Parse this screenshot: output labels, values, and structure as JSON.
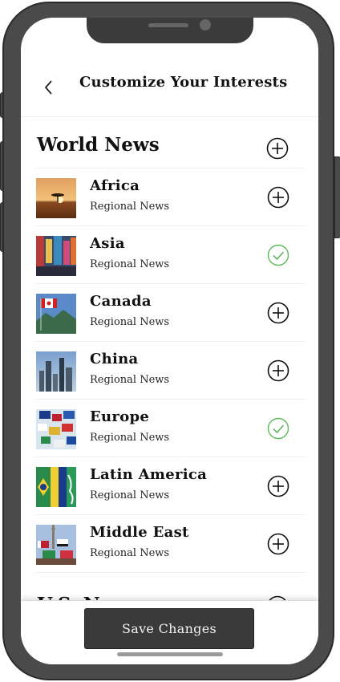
{
  "header": {
    "title": "Customize Your Interests"
  },
  "section": {
    "title": "World News"
  },
  "topics": [
    {
      "name": "Africa",
      "subtitle": "Regional News",
      "selected": false,
      "thumb": "africa-sunset"
    },
    {
      "name": "Asia",
      "subtitle": "Regional News",
      "selected": true,
      "thumb": "asia-street"
    },
    {
      "name": "Canada",
      "subtitle": "Regional News",
      "selected": false,
      "thumb": "canada-flag"
    },
    {
      "name": "China",
      "subtitle": "Regional News",
      "selected": false,
      "thumb": "china-skyline"
    },
    {
      "name": "Europe",
      "subtitle": "Regional News",
      "selected": true,
      "thumb": "europe-flags"
    },
    {
      "name": "Latin America",
      "subtitle": "Regional News",
      "selected": false,
      "thumb": "latin-flags"
    },
    {
      "name": "Middle East",
      "subtitle": "Regional News",
      "selected": false,
      "thumb": "middle-east-flags"
    }
  ],
  "next_section": {
    "title": "U.S. News"
  },
  "footer": {
    "save_label": "Save Changes"
  },
  "colors": {
    "check": "#5cb85c",
    "frame": "#4a4a4a",
    "button": "#3a3a3a"
  }
}
